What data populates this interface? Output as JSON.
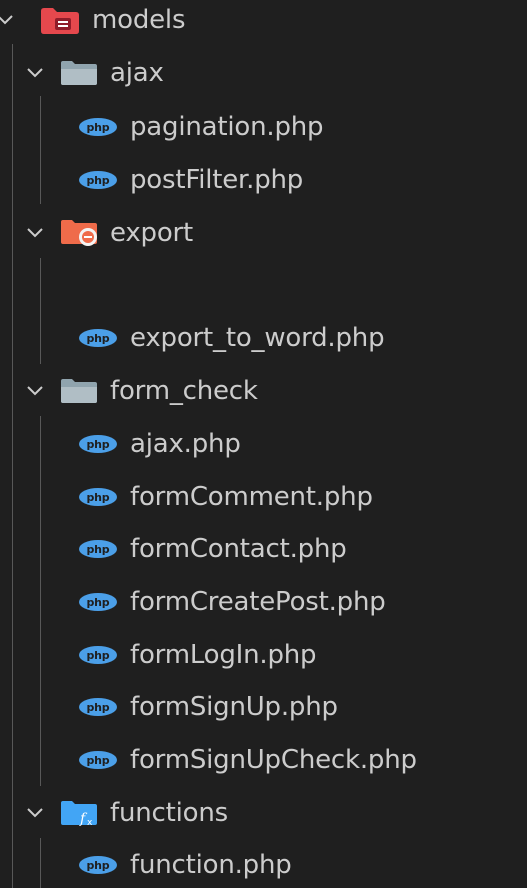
{
  "tree": {
    "root": {
      "label": "models",
      "icon": "models-folder-icon"
    },
    "folders": [
      {
        "label": "ajax",
        "icon": "folder-icon",
        "files": [
          "pagination.php",
          "postFilter.php"
        ]
      },
      {
        "label": "export",
        "icon": "export-folder-icon",
        "files": [
          "export_to_word.php"
        ]
      },
      {
        "label": "form_check",
        "icon": "folder-icon",
        "files": [
          "ajax.php",
          "formComment.php",
          "formContact.php",
          "formCreatePost.php",
          "formLogIn.php",
          "formSignUp.php",
          "formSignUpCheck.php"
        ]
      },
      {
        "label": "functions",
        "icon": "functions-folder-icon",
        "files": [
          "function.php"
        ]
      }
    ],
    "file_icon": "php-file-icon"
  },
  "colors": {
    "background": "#1f1f1f",
    "text": "#cccccc",
    "php_icon": "#4b9fe8",
    "models_folder": "#e5484d",
    "export_folder": "#ef6b4a",
    "plain_folder": "#90a4ae",
    "functions_folder": "#42a5f5"
  }
}
